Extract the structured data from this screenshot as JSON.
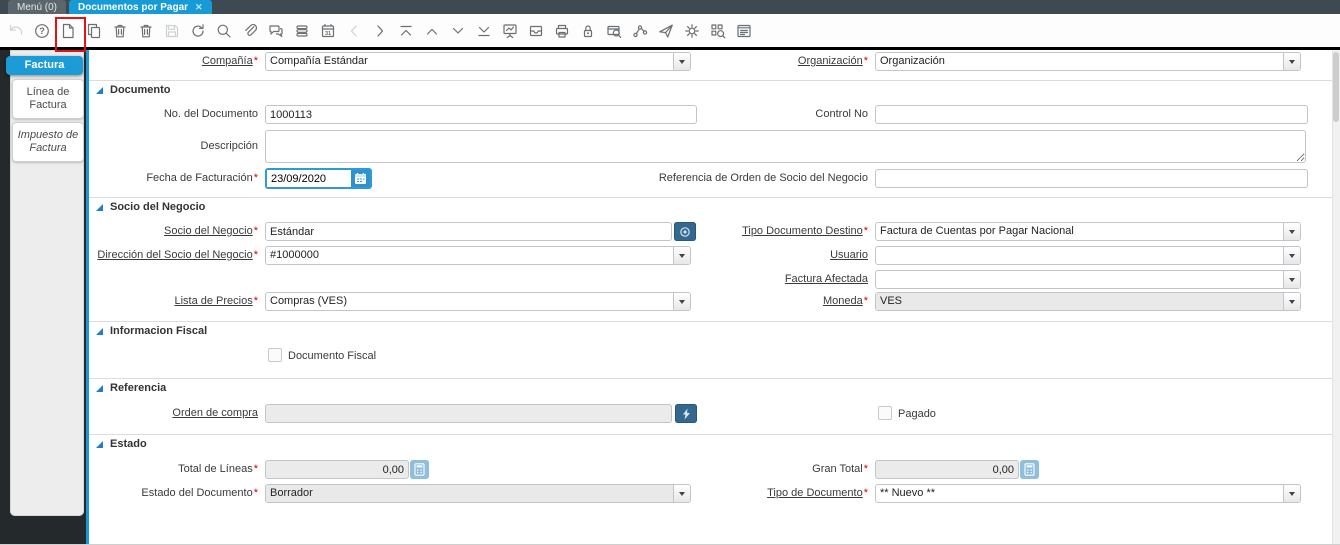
{
  "glyphs": {
    "required": "*",
    "close": "✕"
  },
  "tab_bar": {
    "tabs": [
      {
        "label": "Menú (0)",
        "active": false
      },
      {
        "label": "Documentos por Pagar",
        "active": true
      }
    ]
  },
  "toolbar": {
    "icons": [
      {
        "name": "undo",
        "disabled": true
      },
      {
        "name": "help"
      },
      {
        "name": "new-record",
        "highlighted": true
      },
      {
        "name": "copy-record"
      },
      {
        "name": "delete-record"
      },
      {
        "name": "delete-selection"
      },
      {
        "name": "save",
        "disabled": true
      },
      {
        "name": "refresh"
      },
      {
        "name": "find"
      },
      {
        "name": "attachment"
      },
      {
        "name": "chat"
      },
      {
        "name": "grid-toggle"
      },
      {
        "name": "calendar"
      },
      {
        "name": "chevron-left",
        "disabled": true
      },
      {
        "name": "chevron-right"
      },
      {
        "name": "first-record"
      },
      {
        "name": "move-up"
      },
      {
        "name": "move-down"
      },
      {
        "name": "last-record"
      },
      {
        "name": "report"
      },
      {
        "name": "archive"
      },
      {
        "name": "print"
      },
      {
        "name": "lock"
      },
      {
        "name": "print-preview"
      },
      {
        "name": "workflow"
      },
      {
        "name": "send"
      },
      {
        "name": "settings"
      },
      {
        "name": "qr-scan"
      },
      {
        "name": "window-report"
      }
    ]
  },
  "sidebar": {
    "tabs": [
      {
        "label": "Factura",
        "active": true
      },
      {
        "label": "Línea de Factura",
        "active": false
      },
      {
        "label": "Impuesto de Factura",
        "active": false,
        "italic": true
      }
    ]
  },
  "form": {
    "sections": {
      "documento": "Documento",
      "socio_negocio": "Socio del Negocio",
      "info_fiscal": "Informacion Fiscal",
      "referencia": "Referencia",
      "estado": "Estado"
    },
    "compania": {
      "label": "Compañía",
      "value": "Compañía Estándar"
    },
    "organizacion": {
      "label": "Organización",
      "value": "Organización"
    },
    "no_documento": {
      "label": "No. del Documento",
      "value": "1000113"
    },
    "control_no": {
      "label": "Control No",
      "value": ""
    },
    "descripcion": {
      "label": "Descripción",
      "value": ""
    },
    "fecha_facturacion": {
      "label": "Fecha de Facturación",
      "value": "23/09/2020"
    },
    "referencia_orden": {
      "label": "Referencia de Orden de Socio del Negocio",
      "value": ""
    },
    "socio_negocio": {
      "label": "Socio del Negocio",
      "value": "Estándar"
    },
    "tipo_doc_destino": {
      "label": "Tipo Documento Destino",
      "value": "Factura de Cuentas por Pagar Nacional"
    },
    "direccion_socio": {
      "label": "Dirección del Socio del Negocio",
      "value": "#1000000"
    },
    "usuario": {
      "label": "Usuario",
      "value": ""
    },
    "factura_afectada": {
      "label": "Factura Afectada",
      "value": ""
    },
    "lista_precios": {
      "label": "Lista de Precios",
      "value": "Compras (VES)"
    },
    "moneda": {
      "label": "Moneda",
      "value": "VES"
    },
    "documento_fiscal": {
      "label": "Documento Fiscal",
      "checked": false
    },
    "orden_compra": {
      "label": "Orden de compra",
      "value": ""
    },
    "pagado": {
      "label": "Pagado",
      "checked": false
    },
    "total_lineas": {
      "label": "Total de Líneas",
      "value": "0,00"
    },
    "gran_total": {
      "label": "Gran Total",
      "value": "0,00"
    },
    "estado_documento": {
      "label": "Estado del Documento",
      "value": "Borrador"
    },
    "tipo_documento": {
      "label": "Tipo de Documento",
      "value": "** Nuevo **"
    }
  },
  "colors": {
    "accent_blue": "#1d9bd6",
    "highlight_red": "#e11412",
    "dark_button_blue": "#34688f",
    "calc_button_blue": "#8fbfdd"
  }
}
